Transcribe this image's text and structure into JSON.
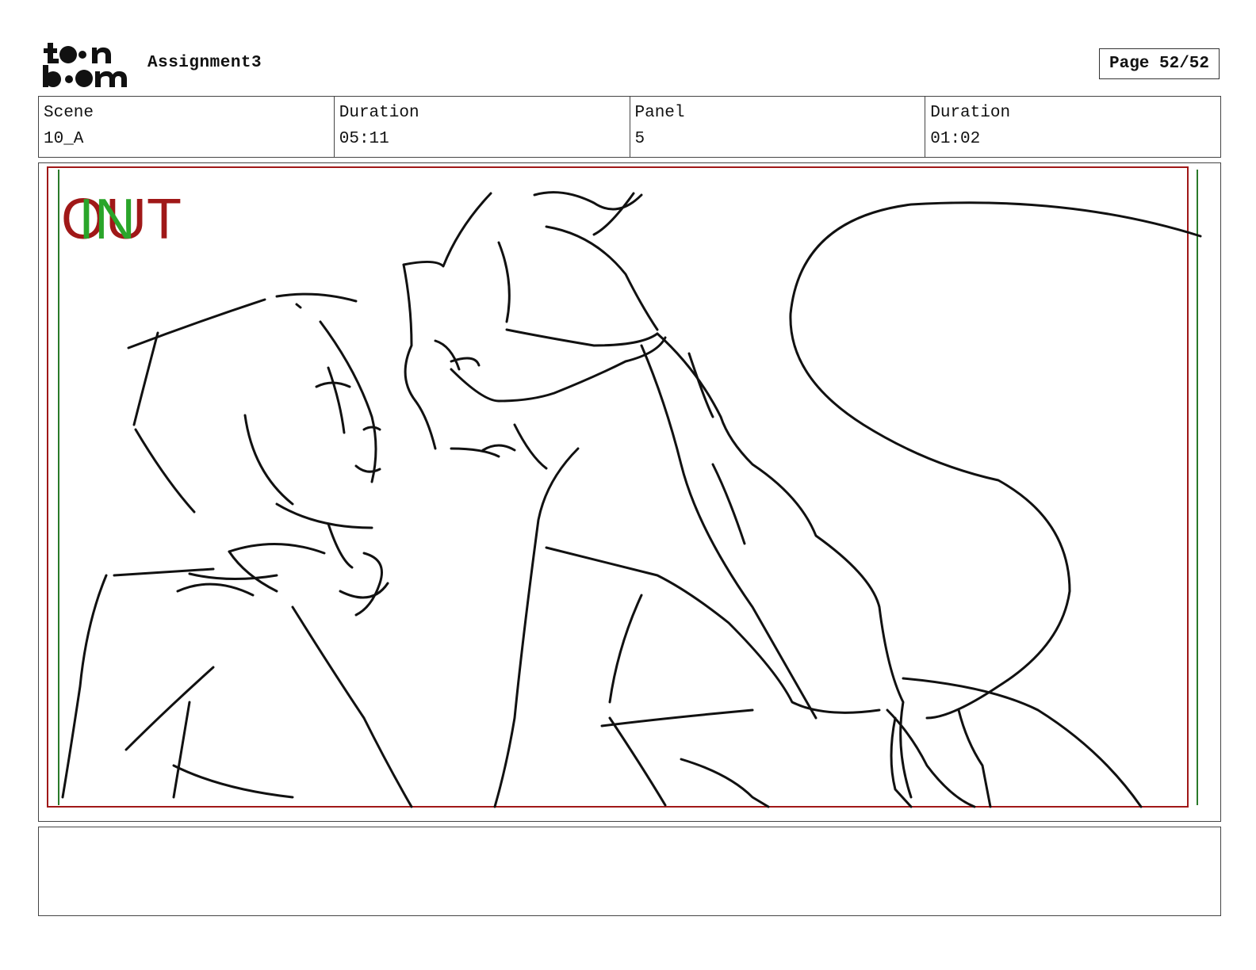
{
  "header": {
    "logo_text": "toon boom",
    "project_title": "Assignment3",
    "page_label": "Page 52/52"
  },
  "info": [
    {
      "label": "Scene",
      "value": "10_A"
    },
    {
      "label": "Duration",
      "value": "05:11"
    },
    {
      "label": "Panel",
      "value": "5"
    },
    {
      "label": "Duration",
      "value": "01:02"
    }
  ],
  "panel": {
    "out_marker": "OUT",
    "in_marker": "IN",
    "colors": {
      "out": "#a01818",
      "in": "#2aa52a",
      "safe_frame_red": "#a01818",
      "safe_frame_green": "#2a7a2a"
    }
  },
  "notes": {
    "text": ""
  }
}
